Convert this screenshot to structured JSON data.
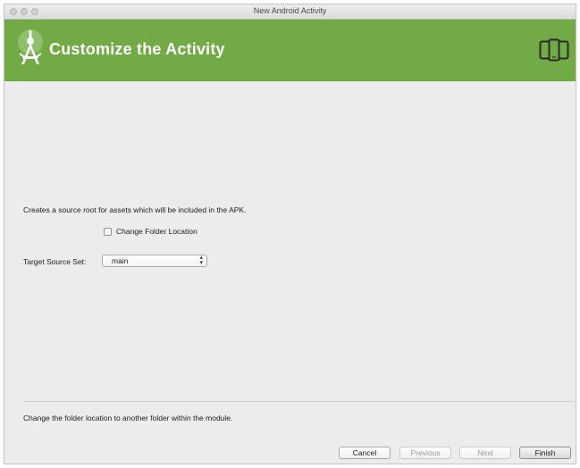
{
  "window": {
    "title": "New Android Activity"
  },
  "header": {
    "title": "Customize the Activity",
    "logo_icon": "android-studio-logo",
    "device_icon": "device-form-factor-icon",
    "background_color": "#72ab45"
  },
  "main": {
    "description": "Creates a source root for assets which will be included in the APK.",
    "change_folder_checkbox": {
      "label": "Change Folder Location",
      "checked": false
    },
    "target_source_set": {
      "label": "Target Source Set:",
      "value": "main"
    }
  },
  "footer": {
    "help_text": "Change the folder location to another folder within the module.",
    "buttons": {
      "cancel": "Cancel",
      "previous": "Previous",
      "next": "Next",
      "finish": "Finish"
    }
  }
}
